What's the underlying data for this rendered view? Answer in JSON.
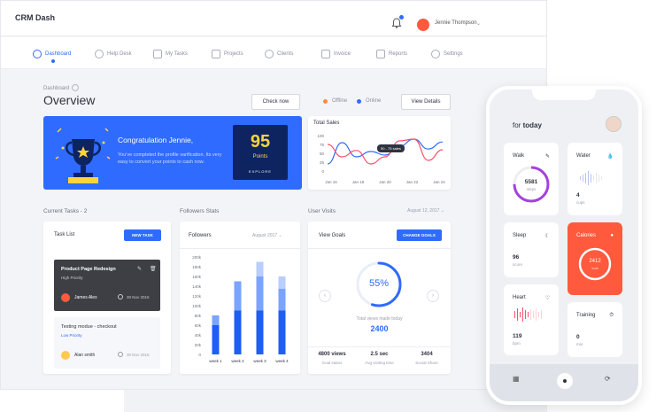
{
  "app": {
    "title": "CRM Dash"
  },
  "user": {
    "name": "Jennie Thompson"
  },
  "nav": [
    {
      "label": "Dashboard",
      "active": true
    },
    {
      "label": "Help Desk"
    },
    {
      "label": "My Tasks"
    },
    {
      "label": "Projects"
    },
    {
      "label": "Clients"
    },
    {
      "label": "Invoice"
    },
    {
      "label": "Reports"
    },
    {
      "label": "Settings"
    }
  ],
  "page": {
    "breadcrumb": "Dashboard",
    "title": "Overview",
    "check_now": "Check now",
    "view_details": "View Details",
    "legend_offline": "Offline",
    "legend_online": "Online",
    "offline_color": "#ff8a3d",
    "online_color": "#2f6bff"
  },
  "congrats": {
    "title": "Congratulation Jennie,",
    "text": "You've completed the profile varification. Its very easy to convert your points to cash now.",
    "points": "95",
    "points_label": "Points",
    "explore": "EXPLORE"
  },
  "total_sales": {
    "title": "Total Sales",
    "tooltip": "50 - 75 sales",
    "chart_data": {
      "type": "line",
      "x": [
        "Jan 16",
        "Jan 18",
        "Jan 20",
        "Jan 22",
        "Jan 24"
      ],
      "ylim": [
        0,
        100
      ],
      "yticks": [
        0,
        25,
        50,
        75,
        100
      ],
      "series": [
        {
          "color": "#2f6bff",
          "values": [
            20,
            80,
            40,
            55,
            45,
            70,
            90,
            62,
            82
          ]
        },
        {
          "color": "#ff4f6d",
          "values": [
            75,
            40,
            58,
            20,
            40,
            85,
            90,
            30,
            60
          ]
        }
      ]
    }
  },
  "tasks": {
    "section": "Current Tasks - 2",
    "list_title": "Task List",
    "new_task": "NEW TASK",
    "items": [
      {
        "title": "Product Page Redesign",
        "priority": "High Priority",
        "assignee": "James Alex",
        "date": "30 Nov 2016",
        "dark": true
      },
      {
        "title": "Testing modue - checkout",
        "priority": "Low Priority",
        "assignee": "Alan smith",
        "date": "30 Nov 2016",
        "dark": false
      }
    ]
  },
  "followers": {
    "section": "Followers Stats",
    "title": "Followers",
    "month": "August 2017",
    "chart_data": {
      "type": "bar",
      "categories": [
        "week 1",
        "week 2",
        "week 3",
        "week 4"
      ],
      "ylim": [
        0,
        200000
      ],
      "yticks": [
        "0",
        "20k",
        "40k",
        "60k",
        "80k",
        "100k",
        "120k",
        "140k",
        "160k",
        "180k",
        "200k"
      ],
      "series": [
        {
          "color": "#1f5ef5",
          "values": [
            60000,
            90000,
            90000,
            90000
          ]
        },
        {
          "color": "#7aa4ff",
          "values": [
            20000,
            60000,
            70000,
            45000
          ]
        },
        {
          "color": "#b9ceff",
          "values": [
            0,
            0,
            30000,
            25000
          ]
        }
      ]
    }
  },
  "visits": {
    "section": "User Visits",
    "date": "August 12, 2017",
    "title": "View Goals",
    "change_goals": "CHANGE GOALS",
    "percent": "55%",
    "percent_value": 0.55,
    "total_label": "Total views made today",
    "total": "2400",
    "stats": [
      {
        "value": "4800 views",
        "label": "Goal status"
      },
      {
        "value": "2.5 sec",
        "label": "Avg visiting time"
      },
      {
        "value": "3404",
        "label": "Social Share"
      }
    ]
  },
  "phone": {
    "title_prefix": "for",
    "title_bold": "today",
    "walk": {
      "name": "Walk",
      "value": "5581",
      "unit": "steps",
      "progress": 0.75
    },
    "water": {
      "name": "Water",
      "value": "4",
      "unit": "cups"
    },
    "sleep": {
      "name": "Sleep",
      "value": "96",
      "unit": "score"
    },
    "calories": {
      "name": "Calories",
      "value": "2412",
      "unit": "kcal"
    },
    "heart": {
      "name": "Heart",
      "value": "119",
      "unit": "bpm"
    },
    "training": {
      "name": "Training",
      "value": "0",
      "unit": "min"
    }
  }
}
